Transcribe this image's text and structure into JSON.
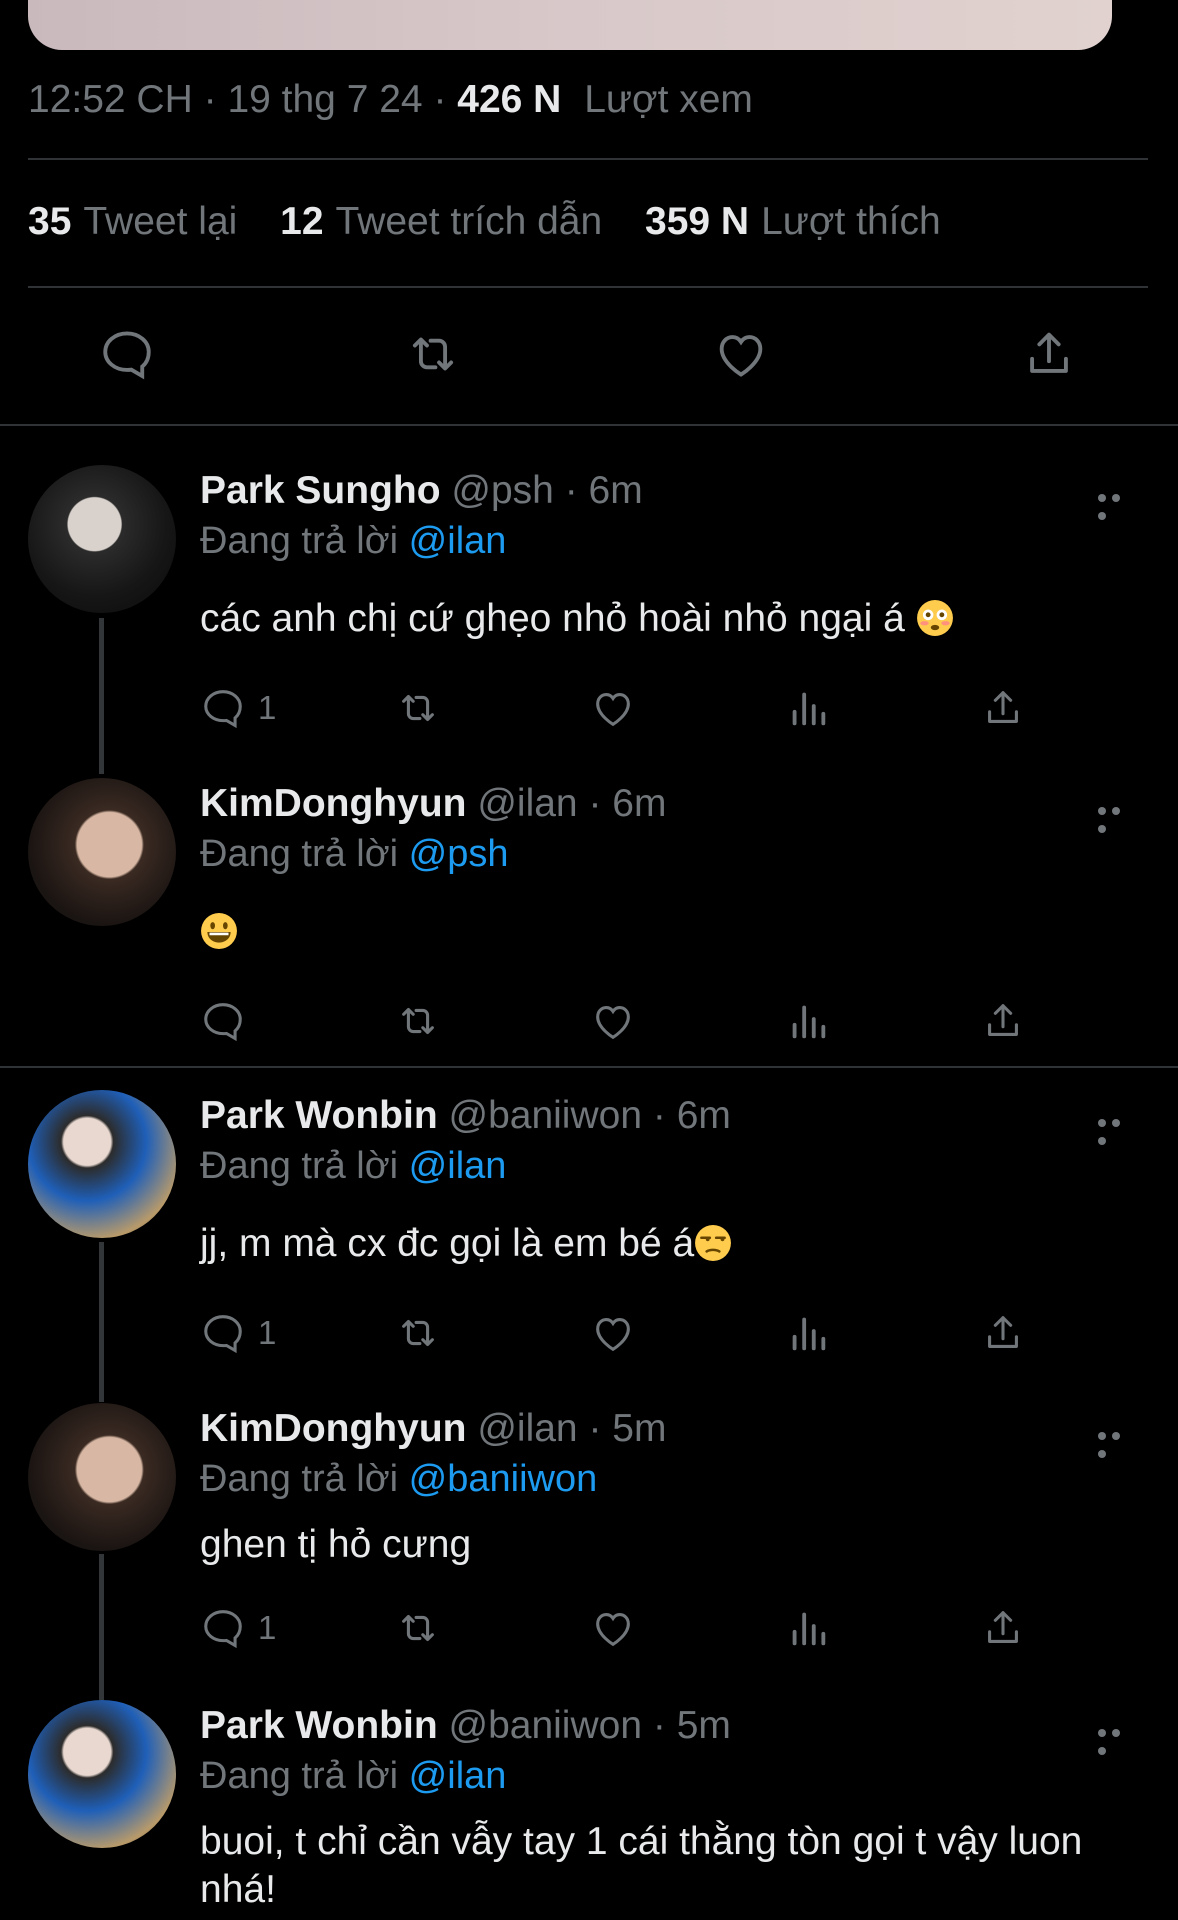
{
  "tweet": {
    "time": "12:52 CH",
    "date": "19 thg 7 24",
    "views_count": "426 N",
    "views_label": "Lượt xem",
    "stats": [
      {
        "count": "35",
        "label": "Tweet lại"
      },
      {
        "count": "12",
        "label": "Tweet trích dẫn"
      },
      {
        "count": "359 N",
        "label": "Lượt thích"
      }
    ]
  },
  "reply_prefix": "Đang trả lời",
  "replies": [
    {
      "name": "Park Sungho",
      "handle": "@psh",
      "time": "6m",
      "replying_to": "@ilan",
      "text": "các anh chị cứ ghẹo nhỏ hoài nhỏ ngại á",
      "emoji": "flushed-face",
      "reply_count": "1"
    },
    {
      "name": "KimDonghyun",
      "handle": "@ilan",
      "time": "6m",
      "replying_to": "@psh",
      "text": "",
      "emoji": "grinning-face",
      "reply_count": ""
    },
    {
      "name": "Park Wonbin",
      "handle": "@baniiwon",
      "time": "6m",
      "replying_to": "@ilan",
      "text": "jj, m mà cx đc gọi là em bé á",
      "emoji": "unamused-face",
      "reply_count": "1"
    },
    {
      "name": "KimDonghyun",
      "handle": "@ilan",
      "time": "5m",
      "replying_to": "@baniiwon",
      "text": "ghen tị hỏ cưng",
      "emoji": "",
      "reply_count": "1"
    },
    {
      "name": "Park Wonbin",
      "handle": "@baniiwon",
      "time": "5m",
      "replying_to": "@ilan",
      "text": "buoi, t chỉ cần vẫy tay 1 cái thằng tòn gọi t vậy luon nhá!",
      "emoji": "",
      "reply_count": ""
    }
  ],
  "colors": {
    "accent": "#1d9bf0",
    "muted": "#71767b",
    "text": "#e7e9ea",
    "background": "#000000"
  }
}
